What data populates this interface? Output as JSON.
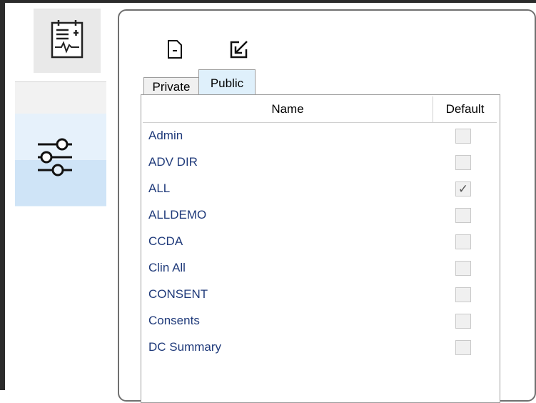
{
  "sidebar": {
    "items": [
      {
        "icon": "patient-chart-icon"
      },
      {
        "icon": "sliders-icon"
      }
    ]
  },
  "toolbar": {
    "icons": [
      "document-minus-icon",
      "edit-export-icon"
    ]
  },
  "tabs": [
    {
      "label": "Private",
      "selected": false
    },
    {
      "label": "Public",
      "selected": true
    }
  ],
  "table": {
    "columns": [
      "Name",
      "Default"
    ],
    "rows": [
      {
        "name": "Admin",
        "default": false
      },
      {
        "name": "ADV DIR",
        "default": false
      },
      {
        "name": "ALL",
        "default": true
      },
      {
        "name": "ALLDEMO",
        "default": false
      },
      {
        "name": "CCDA",
        "default": false
      },
      {
        "name": "Clin All",
        "default": false
      },
      {
        "name": "CONSENT",
        "default": false
      },
      {
        "name": "Consents",
        "default": false
      },
      {
        "name": "DC Summary",
        "default": false
      }
    ]
  },
  "colors": {
    "selected_bg": "#cfe4f7",
    "link_text": "#1f3a7a",
    "tab_selected": "#dff0fb"
  }
}
